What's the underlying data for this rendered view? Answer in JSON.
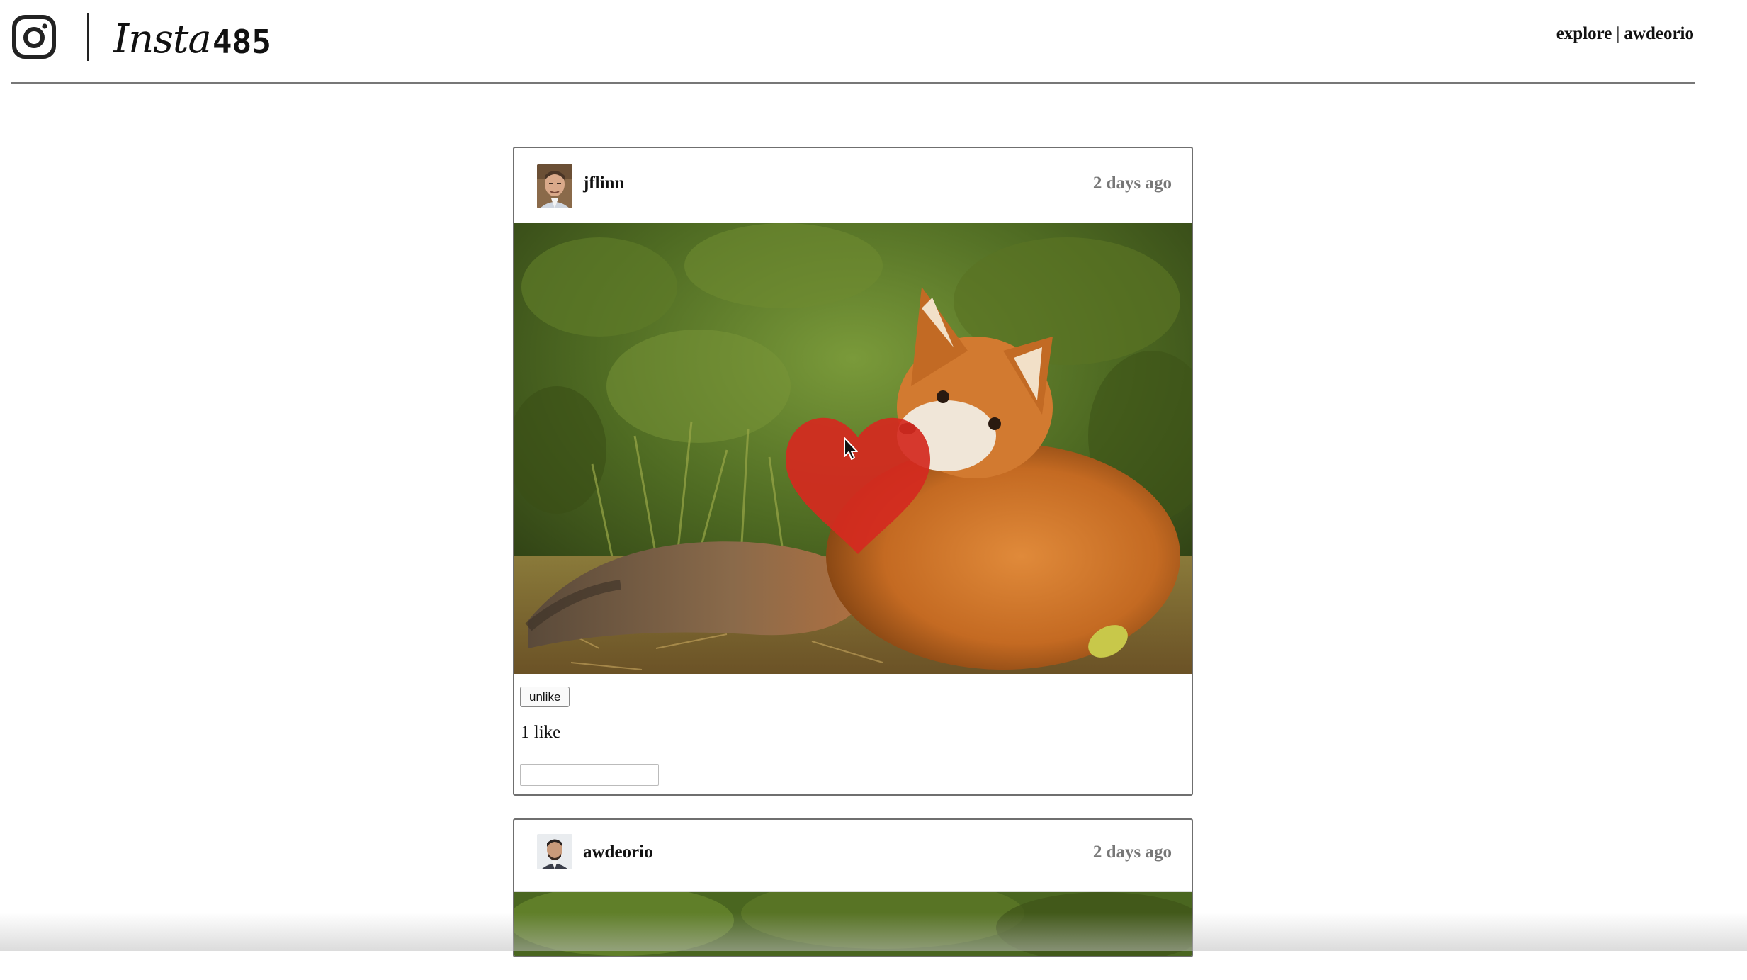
{
  "header": {
    "brand_script": "Insta",
    "brand_number": "485",
    "nav_explore": "explore",
    "nav_separator": "|",
    "nav_user": "awdeorio"
  },
  "posts": [
    {
      "owner": "jflinn",
      "timestamp": "2 days ago",
      "like_button": "unlike",
      "likes_text": "1 like",
      "comment_value": "",
      "liked": true
    },
    {
      "owner": "awdeorio",
      "timestamp": "2 days ago"
    }
  ],
  "colors": {
    "heart": "#d42a1f",
    "border": "#6f6f6f",
    "timestamp": "#777777"
  },
  "icons": {
    "logo": "instagram-camera-icon",
    "like_overlay": "heart-icon",
    "cursor": "mouse-pointer-icon"
  }
}
